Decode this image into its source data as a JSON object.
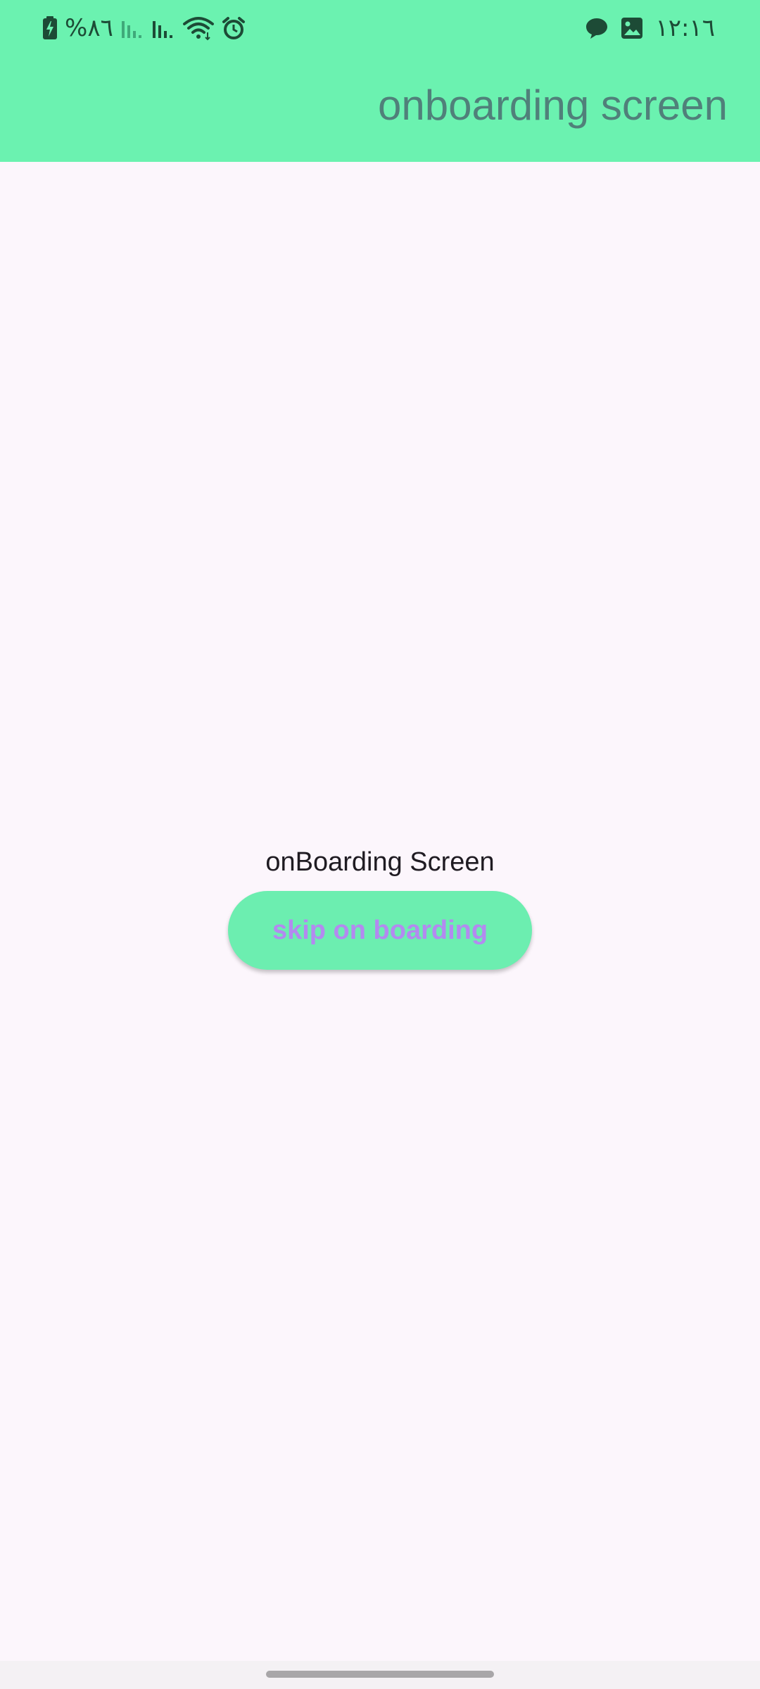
{
  "status_bar": {
    "battery_text": "%٨٦",
    "clock": "١٢:١٦",
    "icons": [
      "battery-charging-icon",
      "signal-weak-icon",
      "signal-icon",
      "wifi-icon",
      "alarm-icon",
      "chat-bubble-icon",
      "image-icon"
    ]
  },
  "app_bar": {
    "title": "onboarding screen",
    "background_color": "#6bf2b0",
    "title_color": "#50807a"
  },
  "main": {
    "text": "onBoarding Screen",
    "skip_button_label": "skip on boarding",
    "button_color": "#6ceeb0",
    "button_text_color": "#b38af0",
    "background_color": "#fcf6fc"
  }
}
